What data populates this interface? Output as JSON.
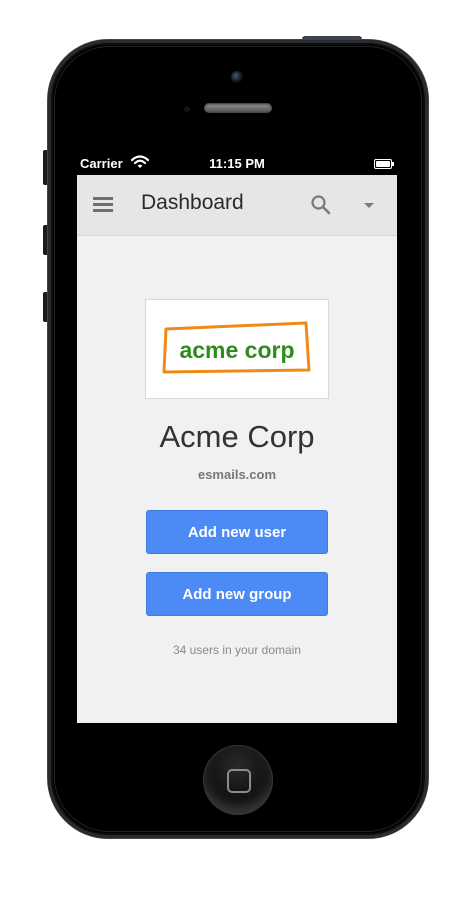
{
  "status_bar": {
    "carrier": "Carrier",
    "time": "11:15 PM",
    "wifi_icon": "wifi-icon",
    "battery_icon": "battery-icon"
  },
  "app_bar": {
    "title": "Dashboard",
    "menu_icon": "hamburger-menu-icon",
    "search_icon": "search-icon",
    "dropdown_icon": "caret-down-icon"
  },
  "organization": {
    "logo_text": "acme corp",
    "name": "Acme Corp",
    "domain": "esmails.com"
  },
  "actions": {
    "add_user_label": "Add new user",
    "add_group_label": "Add new group"
  },
  "summary": {
    "users_text": "34 users in your domain"
  },
  "colors": {
    "primary_button": "#4c8bf5",
    "logo_green": "#2e8b1e",
    "logo_orange": "#ef8a17",
    "app_bar": "#e6e6e6",
    "screen_background": "#f1f1f1"
  }
}
